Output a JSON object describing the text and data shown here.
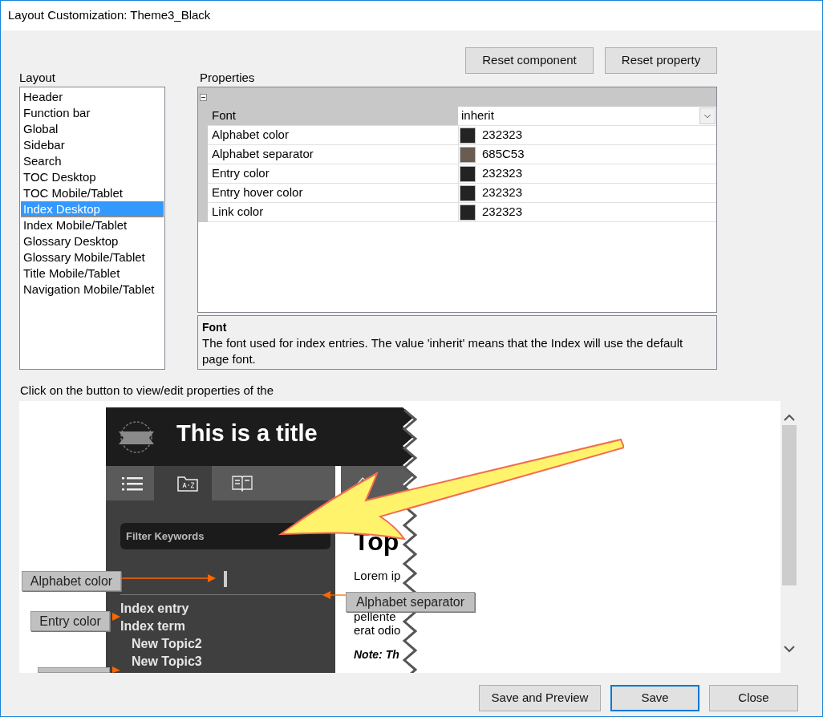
{
  "window": {
    "title": "Layout Customization: Theme3_Black"
  },
  "layout": {
    "label": "Layout",
    "items": [
      {
        "label": "Header",
        "selected": false
      },
      {
        "label": "Function bar",
        "selected": false
      },
      {
        "label": "Global",
        "selected": false
      },
      {
        "label": "Sidebar",
        "selected": false
      },
      {
        "label": "Search",
        "selected": false
      },
      {
        "label": "TOC Desktop",
        "selected": false
      },
      {
        "label": "TOC Mobile/Tablet",
        "selected": false
      },
      {
        "label": "Index Desktop",
        "selected": true
      },
      {
        "label": "Index Mobile/Tablet",
        "selected": false
      },
      {
        "label": "Glossary Desktop",
        "selected": false
      },
      {
        "label": "Glossary Mobile/Tablet",
        "selected": false
      },
      {
        "label": "Title Mobile/Tablet",
        "selected": false
      },
      {
        "label": "Navigation Mobile/Tablet",
        "selected": false
      }
    ]
  },
  "properties": {
    "label": "Properties",
    "buttons": [
      "Reset component",
      "Reset property"
    ],
    "rows": [
      {
        "name": "Font",
        "kind": "dropdown",
        "value": "inherit",
        "selected": true
      },
      {
        "name": "Alphabet color",
        "kind": "color",
        "value": "232323",
        "color": "#232323",
        "selected": false
      },
      {
        "name": "Alphabet separator",
        "kind": "color",
        "value": "685C53",
        "color": "#685c53",
        "selected": false
      },
      {
        "name": "Entry color",
        "kind": "color",
        "value": "232323",
        "color": "#232323",
        "selected": false
      },
      {
        "name": "Entry hover color",
        "kind": "color",
        "value": "232323",
        "color": "#232323",
        "selected": false
      },
      {
        "name": "Link color",
        "kind": "color",
        "value": "232323",
        "color": "#232323",
        "selected": false
      }
    ]
  },
  "description": {
    "title": "Font",
    "text": "The font used for index entries. The value 'inherit' means that the Index will use the default page font."
  },
  "preview": {
    "caption": "Click on the button to view/edit properties of the",
    "screenshot": {
      "title": "This is a title",
      "tabs": [
        {
          "selected": false
        },
        {
          "selected": true
        },
        {
          "selected": false
        }
      ],
      "filter_placeholder": "Filter Keywords",
      "index_entries": [
        {
          "label": "Index entry"
        },
        {
          "label": "Index term",
          "children": [
            {
              "label": "New Topic2"
            },
            {
              "label": "New Topic3"
            }
          ]
        }
      ],
      "content": {
        "heading": "Top",
        "lines": [
          "Lorem ip",
          "pellente",
          "erat odio"
        ],
        "note": "Note: Th"
      }
    },
    "annotations": [
      {
        "label": "Alphabet color"
      },
      {
        "label": "Alphabet separator"
      },
      {
        "label": "Entry color"
      }
    ]
  },
  "buttons": [
    {
      "label": "Save and Preview",
      "default": false
    },
    {
      "label": "Save",
      "default": true
    },
    {
      "label": "Close",
      "default": false
    }
  ]
}
